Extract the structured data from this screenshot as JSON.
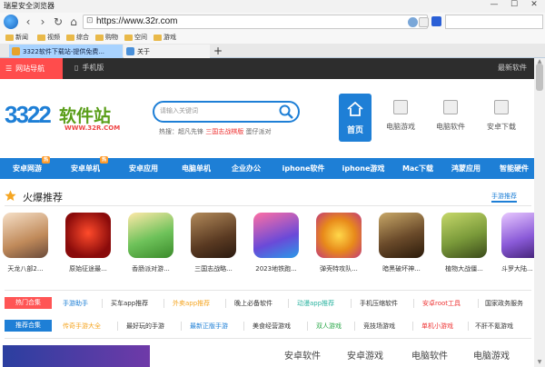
{
  "browser": {
    "title": "瑞星安全浏览器",
    "url": "https://www.32r.com",
    "search_placeholder": "",
    "window_controls": [
      "—",
      "☐",
      "✕"
    ],
    "nav": [
      "‹",
      "›",
      "↻",
      "⌂"
    ],
    "bookmarks": [
      "新闻",
      "视频",
      "综合",
      "购物",
      "空间",
      "游戏"
    ],
    "tabs": [
      {
        "label": "3322软件下载站-提供免费...",
        "active": true
      },
      {
        "label": "关于",
        "active": false
      }
    ],
    "new_tab": "+"
  },
  "site": {
    "topnav": {
      "site_nav": "网站导航",
      "mobile": "手机版",
      "latest": "最新软件"
    },
    "logo": {
      "num": "3322",
      "text": "软件站",
      "domain": "WWW.32R.COM"
    },
    "search": {
      "placeholder": "请输入关键词",
      "hot_prefix": "热搜：",
      "hot_items": [
        "超凡先锋",
        "三国志战棋版",
        "蛋仔派对"
      ]
    },
    "header_nav": [
      "首页",
      "电脑游戏",
      "电脑软件",
      "安卓下载"
    ],
    "categories": [
      {
        "label": "安卓网游",
        "badge": "热"
      },
      {
        "label": "安卓单机",
        "badge": "热"
      },
      {
        "label": "安卓应用",
        "badge": ""
      },
      {
        "label": "电脑单机",
        "badge": ""
      },
      {
        "label": "企业办公",
        "badge": ""
      },
      {
        "label": "iphone软件",
        "badge": ""
      },
      {
        "label": "iphone游戏",
        "badge": ""
      },
      {
        "label": "Mac下载",
        "badge": ""
      },
      {
        "label": "鸿蒙应用",
        "badge": ""
      },
      {
        "label": "智能硬件",
        "badge": ""
      }
    ],
    "hot": {
      "title": "火爆推荐",
      "tab": "手游推荐",
      "apps": [
        "天龙八部2...",
        "原始征途最...",
        "香肠派对游...",
        "三国志战略...",
        "2023地铁跑...",
        "弹壳特攻队...",
        "暗黑破坏神...",
        "植物大战僵...",
        "斗罗大陆..."
      ]
    },
    "rows": [
      {
        "label": "热门合集",
        "color": "#ff5555",
        "tags": [
          {
            "t": "手游助手",
            "c": "#1e7fd6"
          },
          {
            "t": "买车app推荐",
            "c": "#333"
          },
          {
            "t": "外卖app推荐",
            "c": "#f5a623"
          },
          {
            "t": "晚上必备软件",
            "c": "#333"
          },
          {
            "t": "动漫app推荐",
            "c": "#2bb3a0"
          },
          {
            "t": "手机压缩软件",
            "c": "#333"
          },
          {
            "t": "安卓root工具",
            "c": "#e33"
          },
          {
            "t": "国家政务服务",
            "c": "#333"
          }
        ]
      },
      {
        "label": "推荐合集",
        "color": "#1e7fd6",
        "tags": [
          {
            "t": "传奇手游大全",
            "c": "#f5a623"
          },
          {
            "t": "最好玩的手游",
            "c": "#333"
          },
          {
            "t": "最新正版手游",
            "c": "#1e7fd6"
          },
          {
            "t": "美食经营游戏",
            "c": "#333"
          },
          {
            "t": "双人游戏",
            "c": "#2ba84a"
          },
          {
            "t": "竞技场游戏",
            "c": "#333"
          },
          {
            "t": "单机小游戏",
            "c": "#e33"
          },
          {
            "t": "不肝不氪游戏",
            "c": "#333"
          }
        ]
      }
    ],
    "bottom_tabs": [
      "安卓软件",
      "安卓游戏",
      "电脑软件",
      "电脑游戏"
    ]
  }
}
